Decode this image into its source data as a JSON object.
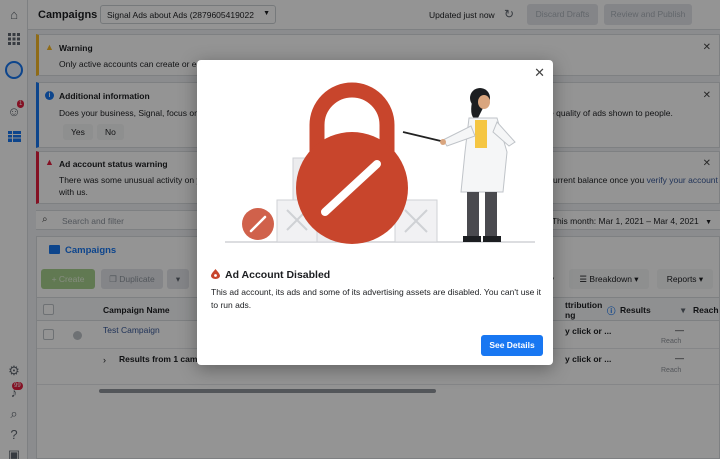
{
  "header": {
    "title": "Campaigns",
    "account_selector": "Signal Ads about Ads (2879605419022",
    "updated_text": "Updated just now",
    "discard_label": "Discard Drafts",
    "review_label": "Review and Publish"
  },
  "sidebar": {
    "notification_badge": "1",
    "alerts_badge": "99"
  },
  "notices": {
    "warning": {
      "title": "Warning",
      "body": "Only active accounts can create or ed"
    },
    "info": {
      "title": "Additional information",
      "body": "Does your business, Signal, focus on",
      "body_right": "e quality of ads shown to people.",
      "yes_label": "Yes",
      "no_label": "No"
    },
    "status": {
      "title": "Ad account status warning",
      "body_line1": "There was some unusual activity on yo",
      "body_line2": "with us.",
      "body_right_1": "urrent balance once you ",
      "body_right_link": "verify your account"
    }
  },
  "search": {
    "placeholder": "Search and filter",
    "date_range": "This month: Mar 1, 2021 – Mar 4, 2021"
  },
  "table": {
    "tab_label": "Campaigns",
    "create_label": "+ Create",
    "duplicate_label": "Duplicate",
    "breakdown_label": "Breakdown",
    "reports_label": "Reports",
    "headers": {
      "campaign_name": "Campaign Name",
      "attribution_1": "ttribution",
      "attribution_2": "ng",
      "results": "Results",
      "reach": "Reach"
    },
    "row1": {
      "name": "Test Campaign",
      "attr": "y click or ...",
      "results_dash": "—",
      "reach_dash": "—",
      "reach_sub": "Reach"
    },
    "row2": {
      "name": "Results from 1 camp",
      "attr": "y click or ...",
      "results_dash": "—",
      "reach_dash": "—",
      "reach_sub": "Reach"
    }
  },
  "modal": {
    "title": "Ad Account Disabled",
    "body": "This ad account, its ads and some of its advertising assets are disabled. You can't use it to run ads.",
    "button_label": "See Details",
    "colors": {
      "lock": "#c8452c",
      "primary": "#1877f2"
    }
  }
}
